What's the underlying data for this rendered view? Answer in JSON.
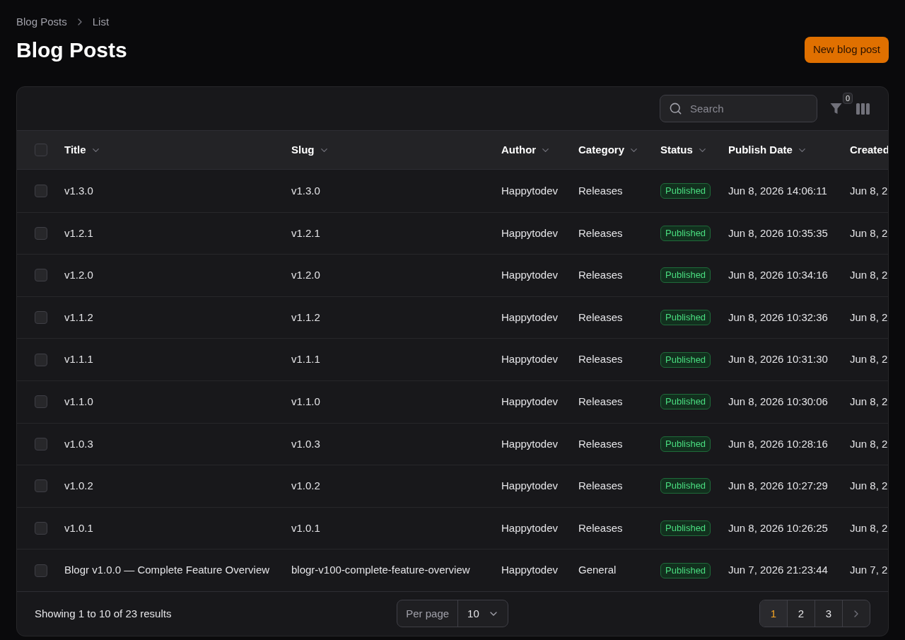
{
  "breadcrumbs": [
    {
      "label": "Blog Posts"
    },
    {
      "label": "List"
    }
  ],
  "page": {
    "title": "Blog Posts",
    "action": "New blog post"
  },
  "toolbar": {
    "search": {
      "placeholder": "Search"
    },
    "filter_badge": "0"
  },
  "table": {
    "all_checked": false,
    "columns": [
      {
        "label": "Title",
        "kind": "text",
        "sort_icon": true
      },
      {
        "label": "Slug",
        "kind": "text",
        "sort_icon": true
      },
      {
        "label": "Author",
        "kind": "text",
        "sort_icon": true
      },
      {
        "label": "Category",
        "kind": "text",
        "sort_icon": true
      },
      {
        "label": "Status",
        "kind": "badge",
        "sort_icon": true
      },
      {
        "label": "Publish Date",
        "kind": "text",
        "sort_icon": true
      },
      {
        "label": "Created",
        "kind": "text",
        "sort_icon": false
      }
    ],
    "rows": [
      {
        "checked": false,
        "cells": [
          "v1.3.0",
          "v1.3.0",
          "Happytodev",
          "Releases",
          "Published",
          "Jun 8, 2026 14:06:11",
          "Jun 8, 2"
        ]
      },
      {
        "checked": false,
        "cells": [
          "v1.2.1",
          "v1.2.1",
          "Happytodev",
          "Releases",
          "Published",
          "Jun 8, 2026 10:35:35",
          "Jun 8, 2"
        ]
      },
      {
        "checked": false,
        "cells": [
          "v1.2.0",
          "v1.2.0",
          "Happytodev",
          "Releases",
          "Published",
          "Jun 8, 2026 10:34:16",
          "Jun 8, 2"
        ]
      },
      {
        "checked": false,
        "cells": [
          "v1.1.2",
          "v1.1.2",
          "Happytodev",
          "Releases",
          "Published",
          "Jun 8, 2026 10:32:36",
          "Jun 8, 2"
        ]
      },
      {
        "checked": false,
        "cells": [
          "v1.1.1",
          "v1.1.1",
          "Happytodev",
          "Releases",
          "Published",
          "Jun 8, 2026 10:31:30",
          "Jun 8, 2"
        ]
      },
      {
        "checked": false,
        "cells": [
          "v1.1.0",
          "v1.1.0",
          "Happytodev",
          "Releases",
          "Published",
          "Jun 8, 2026 10:30:06",
          "Jun 8, 2"
        ]
      },
      {
        "checked": false,
        "cells": [
          "v1.0.3",
          "v1.0.3",
          "Happytodev",
          "Releases",
          "Published",
          "Jun 8, 2026 10:28:16",
          "Jun 8, 2"
        ]
      },
      {
        "checked": false,
        "cells": [
          "v1.0.2",
          "v1.0.2",
          "Happytodev",
          "Releases",
          "Published",
          "Jun 8, 2026 10:27:29",
          "Jun 8, 2"
        ]
      },
      {
        "checked": false,
        "cells": [
          "v1.0.1",
          "v1.0.1",
          "Happytodev",
          "Releases",
          "Published",
          "Jun 8, 2026 10:26:25",
          "Jun 8, 2"
        ]
      },
      {
        "checked": false,
        "cells": [
          "Blogr v1.0.0 — Complete Feature Overview",
          "blogr-v100-complete-feature-overview",
          "Happytodev",
          "General",
          "Published",
          "Jun 7, 2026 21:23:44",
          "Jun 7, 2"
        ]
      }
    ]
  },
  "footer": {
    "summary": "Showing 1 to 10 of 23 results",
    "per_page": {
      "label": "Per page",
      "value": "10"
    },
    "pages": [
      {
        "label": "1",
        "selected": true
      },
      {
        "label": "2",
        "selected": false
      },
      {
        "label": "3",
        "selected": false
      }
    ]
  }
}
